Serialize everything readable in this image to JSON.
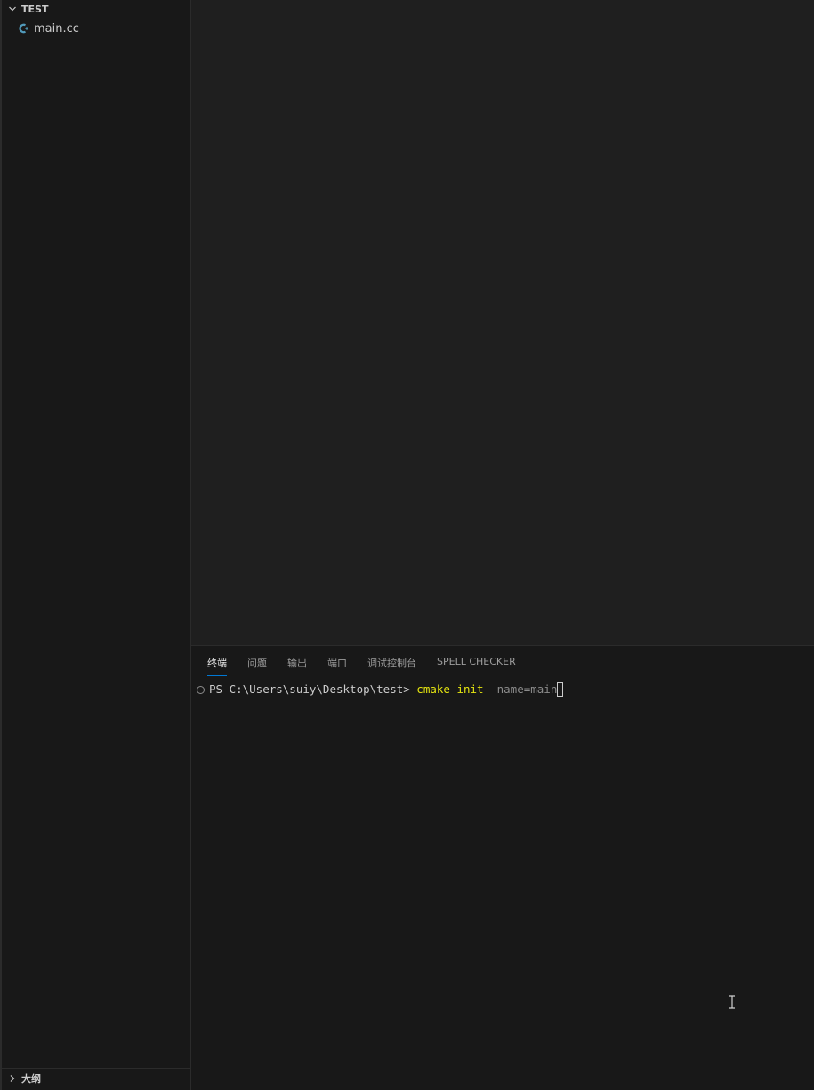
{
  "sidebar": {
    "explorer_title": "TEST",
    "files": [
      {
        "name": "main.cc",
        "icon": "cpp-file-icon"
      }
    ],
    "outline_title": "大纲"
  },
  "panel": {
    "tabs": [
      {
        "label": "终端",
        "active": true
      },
      {
        "label": "问题",
        "active": false
      },
      {
        "label": "输出",
        "active": false
      },
      {
        "label": "端口",
        "active": false
      },
      {
        "label": "调试控制台",
        "active": false
      },
      {
        "label": "SPELL CHECKER",
        "active": false
      }
    ],
    "terminal": {
      "prompt": "PS C:\\Users\\suiy\\Desktop\\test> ",
      "command": "cmake-init",
      "args": " -name=main"
    }
  },
  "colors": {
    "accent": "#0078d4",
    "command": "#e5e510"
  }
}
